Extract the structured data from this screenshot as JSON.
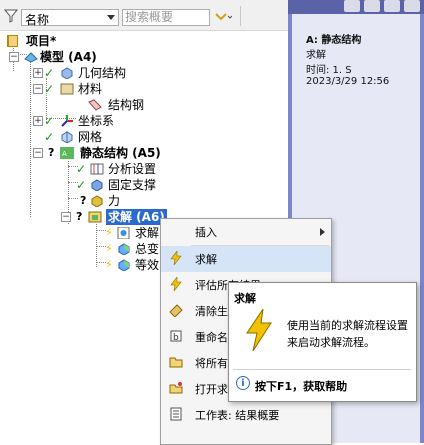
{
  "toolbar": {
    "filter_select_value": "名称",
    "search_placeholder": "搜索概要"
  },
  "tree": {
    "project": "项目*",
    "model": "模型 (A4)",
    "geometry": "几何结构",
    "materials": "材料",
    "structural_steel": "结构钢",
    "coordinate_systems": "坐标系",
    "mesh": "网格",
    "static_structural": "静态结构 (A5)",
    "analysis_settings": "分析设置",
    "fixed_support": "固定支撑",
    "force": "力",
    "solution": "求解 (A6)",
    "child_solution_info": "求解",
    "child_total_deformation": "总变",
    "child_equivalent_stress": "等效"
  },
  "details_panel": {
    "title": "A: 静态结构",
    "subtitle": "求解",
    "time": "时间: 1. S",
    "date": "2023/3/29 12:56"
  },
  "context_menu": {
    "items": [
      {
        "label": "插入"
      },
      {
        "label": "求解"
      },
      {
        "label": "评估所有结果"
      },
      {
        "label": "清除生"
      },
      {
        "label": "重命名"
      },
      {
        "label": "将所有"
      },
      {
        "label": "打开求"
      },
      {
        "label": "工作表: 结果概要"
      }
    ]
  },
  "tooltip": {
    "title": "求解",
    "description": "使用当前的求解流程设置来启动求解流程。",
    "help": "按下F1，获取帮助"
  },
  "colors": {
    "selection": "#2a6acb",
    "check_green": "#1a9b1a",
    "bolt_yellow": "#f2c200",
    "right_panel": "#7b86d1"
  }
}
